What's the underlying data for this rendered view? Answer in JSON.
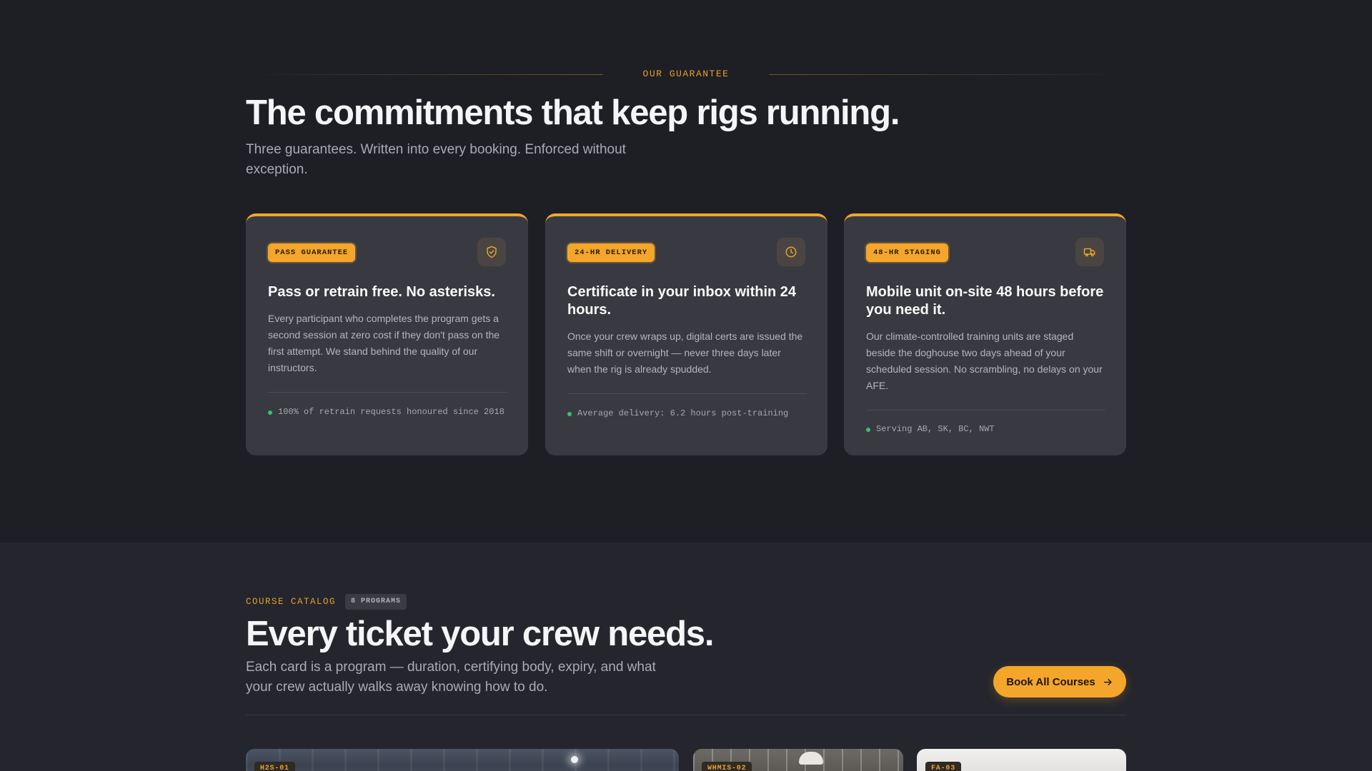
{
  "guarantee": {
    "eyebrow": "OUR GUARANTEE",
    "title": "The commitments that keep rigs running.",
    "subtitle": "Three guarantees. Written into every booking. Enforced without exception.",
    "cards": [
      {
        "tag": "PASS GUARANTEE",
        "icon": "shield-check-icon",
        "title": "Pass or retrain free. No asterisks.",
        "body": "Every participant who completes the program gets a second session at zero cost if they don't pass on the first attempt. We stand behind the quality of our instructors.",
        "foot": "100% of retrain requests honoured since 2018"
      },
      {
        "tag": "24-HR DELIVERY",
        "icon": "clock-icon",
        "title": "Certificate in your inbox within 24 hours.",
        "body": "Once your crew wraps up, digital certs are issued the same shift or overnight — never three days later when the rig is already spudded.",
        "foot": "Average delivery: 6.2 hours post-training"
      },
      {
        "tag": "48-HR STAGING",
        "icon": "truck-icon",
        "title": "Mobile unit on-site 48 hours before you need it.",
        "body": "Our climate-controlled training units are staged beside the doghouse two days ahead of your scheduled session. No scrambling, no delays on your AFE.",
        "foot": "Serving AB, SK, BC, NWT"
      }
    ]
  },
  "catalog": {
    "eyebrow": "COURSE CATALOG",
    "count": "8 PROGRAMS",
    "title": "Every ticket your crew needs.",
    "subtitle": "Each card is a program — duration, certifying body, expiry, and what your crew actually walks away knowing how to do.",
    "button": "Book All Courses",
    "courses": [
      {
        "code": "H2S-01"
      },
      {
        "code": "WHMIS-02"
      },
      {
        "code": "FA-03"
      }
    ]
  },
  "colors": {
    "accent": "#f4a62a",
    "background": "#1e1f25",
    "card": "#393a41",
    "status_dot": "#3fbf6f"
  }
}
